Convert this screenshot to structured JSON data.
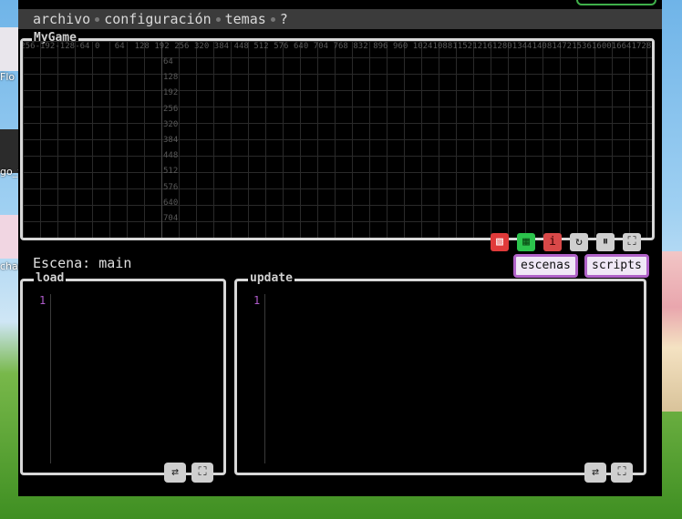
{
  "desktop": {
    "labels": [
      "Flo",
      "go_v",
      "char"
    ]
  },
  "menu": {
    "items": [
      "archivo",
      "configuración",
      "temas",
      "?"
    ]
  },
  "game": {
    "title": "MyGame",
    "x_ticks": [
      "-320",
      "-256",
      "-192",
      "-128",
      "-64",
      "0",
      "64",
      "128",
      "192",
      "256",
      "320",
      "384",
      "448",
      "512",
      "576",
      "640",
      "704",
      "768",
      "832",
      "896",
      "960",
      "1024",
      "1088",
      "1152",
      "1216",
      "1280",
      "1344",
      "1408",
      "1472",
      "1536",
      "1600",
      "1664",
      "1728"
    ],
    "y_ticks": [
      "64",
      "128",
      "192",
      "256",
      "320",
      "384",
      "448",
      "512",
      "576",
      "640",
      "704"
    ],
    "toolbar": {
      "btn1_icon": "▧",
      "btn2_icon": "▦",
      "btn3_icon": "i",
      "reload_icon": "↻",
      "pause_icon": "⏸",
      "fullscreen_icon": "⛶"
    }
  },
  "scene": {
    "label": "Escena: main",
    "escenas_label": "escenas",
    "scripts_label": "scripts"
  },
  "editors": {
    "load": {
      "title": "load",
      "line": "1",
      "swap_icon": "⇄",
      "expand_icon": "⛶"
    },
    "update": {
      "title": "update",
      "line": "1",
      "swap_icon": "⇄",
      "expand_icon": "⛶"
    }
  }
}
